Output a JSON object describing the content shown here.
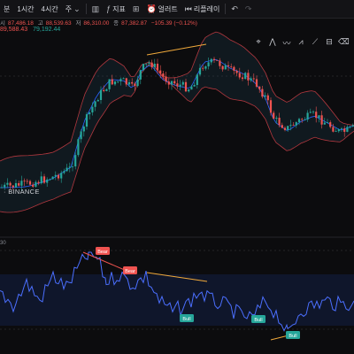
{
  "toolbar": {
    "items": [
      {
        "label": "분",
        "icon": ""
      },
      {
        "label": "1시간",
        "icon": ""
      },
      {
        "label": "4시간",
        "icon": ""
      },
      {
        "label": "주",
        "icon": "chevron-down"
      },
      {
        "label": "",
        "icon": "candlestick-icon"
      },
      {
        "label": "지표",
        "icon": "fx-icon"
      },
      {
        "label": "",
        "icon": "grid-icon"
      },
      {
        "label": "얼러트",
        "icon": "alarm-icon"
      },
      {
        "label": "리플레이",
        "icon": "replay-icon"
      },
      {
        "label": "",
        "icon": "undo-icon"
      }
    ]
  },
  "ohlc": {
    "o_label": "시",
    "o": "87,486.18",
    "h_label": "고",
    "h": "88,539.63",
    "l_label": "저",
    "l": "86,310.00",
    "c_label": "종",
    "c": "87,382.87",
    "change": "−105.39 (−0.12%)"
  },
  "indicators": {
    "bb_upper": "89,588.43",
    "bb_lower": "79,192.44"
  },
  "symbol": {
    "exchange": "BINANCE"
  },
  "rsi": {
    "label": "30"
  },
  "signals": [
    {
      "label": "Bear"
    },
    {
      "label": "Bear"
    },
    {
      "label": "Bull"
    },
    {
      "label": "Bull"
    },
    {
      "label": "Bull"
    }
  ],
  "colors": {
    "up": "#26a69a",
    "down": "#ef5350",
    "bb_band": "#b2383f",
    "bb_mid": "#2962ff",
    "rsi": "#4b6fff",
    "divergence": "#f0a93b",
    "background": "#0c0c0e"
  }
}
